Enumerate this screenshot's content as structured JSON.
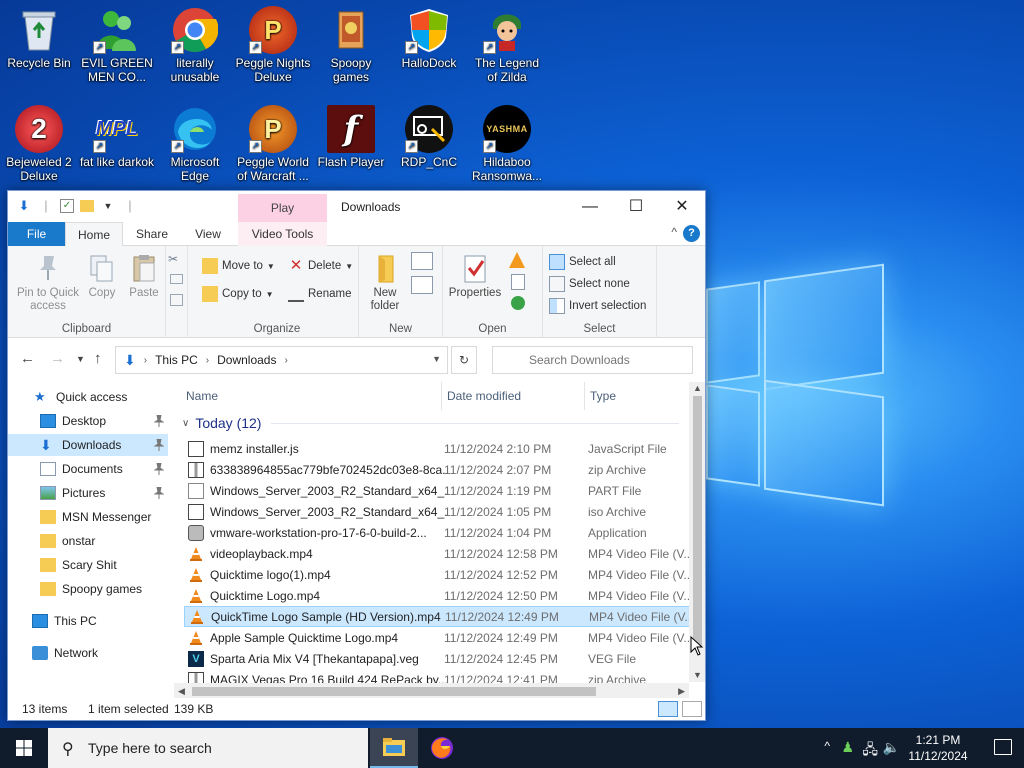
{
  "desktop": {
    "icons": [
      {
        "label": "Recycle Bin"
      },
      {
        "label": "EVIL GREEN MEN CO..."
      },
      {
        "label": "literally unusable"
      },
      {
        "label": "Peggle Nights Deluxe"
      },
      {
        "label": "Spoopy games"
      },
      {
        "label": "HalloDock"
      },
      {
        "label": "The Legend of Zilda"
      },
      {
        "label": "Bejeweled 2 Deluxe"
      },
      {
        "label": "fat like darkok"
      },
      {
        "label": "Microsoft Edge"
      },
      {
        "label": "Peggle World of Warcraft ..."
      },
      {
        "label": "Flash Player"
      },
      {
        "label": "RDP_CnC"
      },
      {
        "label": "Hildaboo Ransomwa..."
      }
    ],
    "icon_texts": {
      "bejeweled": "2",
      "mpl": "MPL",
      "peggle": "P",
      "yashma": "YASHMA",
      "flash": "f"
    }
  },
  "window": {
    "title": "Downloads",
    "context_tab": "Play",
    "caption": {
      "minimize": "—",
      "maximize": "☐",
      "close": "✕"
    },
    "tabs": {
      "file": "File",
      "home": "Home",
      "share": "Share",
      "view": "View",
      "video_tools": "Video Tools"
    },
    "help": "?",
    "collapse": "^"
  },
  "ribbon": {
    "clipboard": {
      "label": "Clipboard",
      "pin": "Pin to Quick access",
      "copy": "Copy",
      "paste": "Paste"
    },
    "organize": {
      "label": "Organize",
      "move_to": "Move to",
      "copy_to": "Copy to",
      "delete": "Delete",
      "rename": "Rename"
    },
    "new": {
      "label": "New",
      "new_folder": "New folder"
    },
    "open": {
      "label": "Open",
      "properties": "Properties"
    },
    "select": {
      "label": "Select",
      "select_all": "Select all",
      "select_none": "Select none",
      "invert": "Invert selection"
    }
  },
  "address": {
    "crumbs": [
      "This PC",
      "Downloads"
    ],
    "search_placeholder": "Search Downloads"
  },
  "nav": {
    "items": [
      {
        "label": "Quick access"
      },
      {
        "label": "Desktop"
      },
      {
        "label": "Downloads"
      },
      {
        "label": "Documents"
      },
      {
        "label": "Pictures"
      },
      {
        "label": "MSN Messenger"
      },
      {
        "label": "onstar"
      },
      {
        "label": "Scary Shit"
      },
      {
        "label": "Spoopy games"
      },
      {
        "label": "This PC"
      },
      {
        "label": "Network"
      }
    ]
  },
  "files": {
    "columns": {
      "name": "Name",
      "date": "Date modified",
      "type": "Type"
    },
    "group": "Today (12)",
    "rows": [
      {
        "name": "memz installer.js",
        "date": "11/12/2024 2:10 PM",
        "type": "JavaScript File"
      },
      {
        "name": "633838964855ac779bfe702452dc03e8-8ca...",
        "date": "11/12/2024 2:07 PM",
        "type": "zip Archive"
      },
      {
        "name": "Windows_Server_2003_R2_Standard_x64_...",
        "date": "11/12/2024 1:19 PM",
        "type": "PART File"
      },
      {
        "name": "Windows_Server_2003_R2_Standard_x64_...",
        "date": "11/12/2024 1:05 PM",
        "type": "iso Archive"
      },
      {
        "name": "vmware-workstation-pro-17-6-0-build-2...",
        "date": "11/12/2024 1:04 PM",
        "type": "Application"
      },
      {
        "name": "videoplayback.mp4",
        "date": "11/12/2024 12:58 PM",
        "type": "MP4 Video File (V..."
      },
      {
        "name": "Quicktime logo(1).mp4",
        "date": "11/12/2024 12:52 PM",
        "type": "MP4 Video File (V..."
      },
      {
        "name": "Quicktime Logo.mp4",
        "date": "11/12/2024 12:50 PM",
        "type": "MP4 Video File (V..."
      },
      {
        "name": "QuickTime Logo Sample (HD Version).mp4",
        "date": "11/12/2024 12:49 PM",
        "type": "MP4 Video File (V..."
      },
      {
        "name": "Apple Sample Quicktime Logo.mp4",
        "date": "11/12/2024 12:49 PM",
        "type": "MP4 Video File (V..."
      },
      {
        "name": "Sparta Aria Mix V4 [Thekantapapa].veg",
        "date": "11/12/2024 12:45 PM",
        "type": "VEG File"
      },
      {
        "name": "MAGIX Vegas Pro 16 Build 424 RePack by...",
        "date": "11/12/2024 12:41 PM",
        "type": "zip Archive"
      }
    ]
  },
  "status": {
    "count": "13 items",
    "selected": "1 item selected",
    "size": "139 KB"
  },
  "taskbar": {
    "search_placeholder": "Type here to search",
    "time": "1:21 PM",
    "date": "11/12/2024"
  },
  "colors": {
    "accent": "#1979ca",
    "selection": "#cce8ff",
    "taskbar": "#101c2c",
    "context_tab": "#fbd1e3"
  }
}
